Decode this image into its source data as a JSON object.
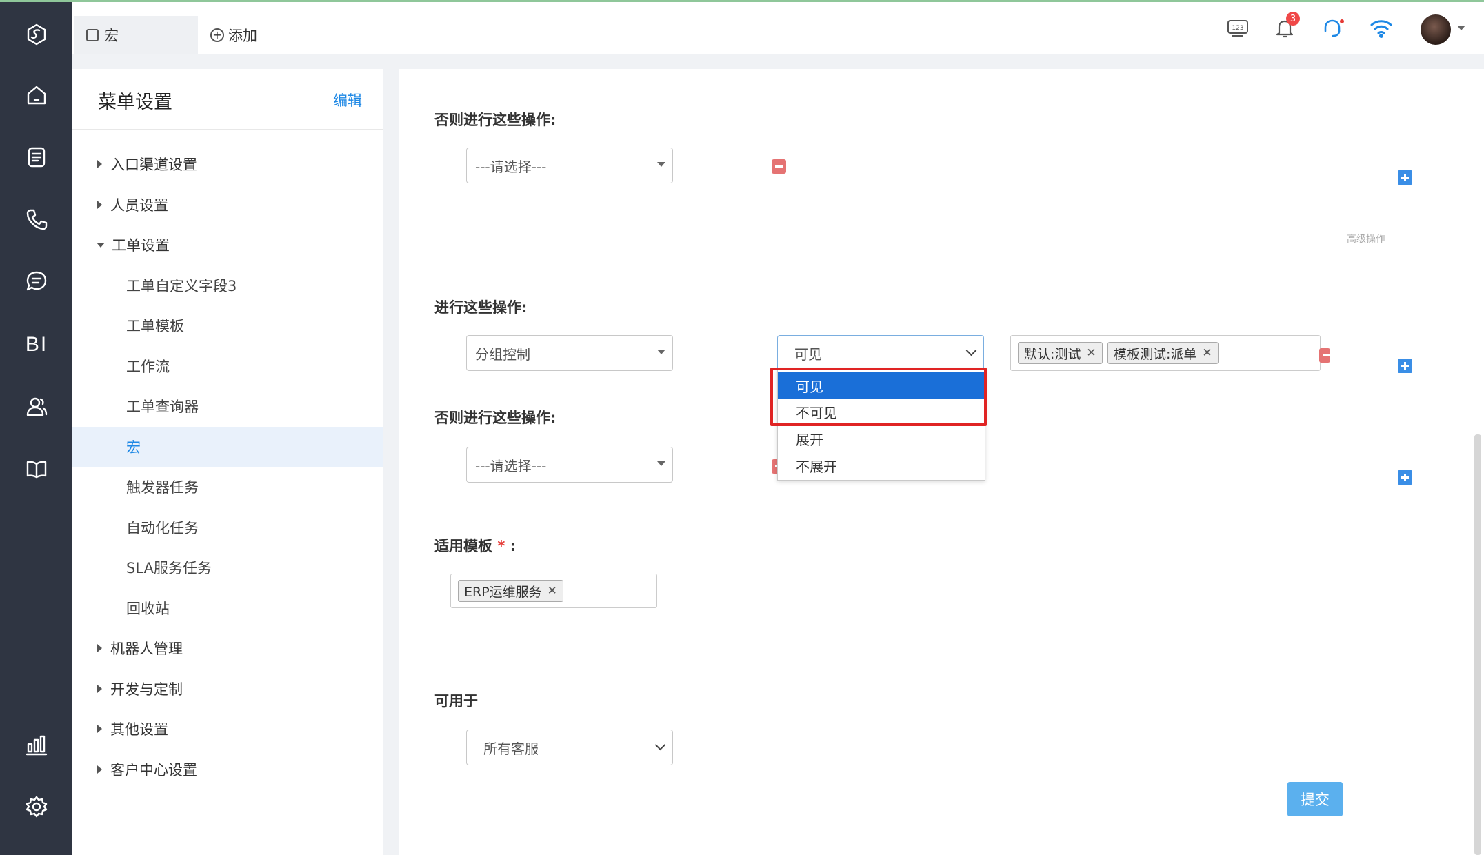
{
  "header": {
    "active_tab": "宏",
    "add_tab": "添加",
    "notification_count": "3"
  },
  "rail": {
    "bi_label": "BI",
    "icons": [
      "logo-icon",
      "home-icon",
      "document-icon",
      "phone-icon",
      "chat-icon",
      "bi-icon",
      "user-icon",
      "book-icon",
      "stats-icon",
      "settings-icon"
    ]
  },
  "menu": {
    "title": "菜单设置",
    "edit": "编辑",
    "items": [
      {
        "label": "入口渠道设置"
      },
      {
        "label": "人员设置"
      },
      {
        "label": "工单设置"
      },
      {
        "label": "工单自定义字段3"
      },
      {
        "label": "工单模板"
      },
      {
        "label": "工作流"
      },
      {
        "label": "工单查询器"
      },
      {
        "label": "宏"
      },
      {
        "label": "触发器任务"
      },
      {
        "label": "自动化任务"
      },
      {
        "label": "SLA服务任务"
      },
      {
        "label": "回收站"
      },
      {
        "label": "机器人管理"
      },
      {
        "label": "开发与定制"
      },
      {
        "label": "其他设置"
      },
      {
        "label": "客户中心设置"
      }
    ]
  },
  "form": {
    "else_label_1": "否则进行这些操作:",
    "else_select_1": "---请选择---",
    "advanced": "高级操作",
    "do_label": "进行这些操作:",
    "action_select": "分组控制",
    "visibility_select": "可见",
    "dropdown_options": [
      "可见",
      "不可见",
      "展开",
      "不展开"
    ],
    "group_tags": [
      "默认:测试",
      "模板测试:派单"
    ],
    "else_label_2": "否则进行这些操作:",
    "else_select_2": "---请选择---",
    "template_label": "适用模板",
    "template_required": "*",
    "template_colon": ":",
    "template_tags": [
      "ERP运维服务"
    ],
    "available_label": "可用于",
    "available_select": "所有客服",
    "submit": "提交"
  },
  "colors": {
    "rail_bg": "#2f3542",
    "accent": "#1e88e5",
    "selected_option": "#1a6fd8",
    "highlight_border": "#e02424",
    "submit_bg": "#5bb0ee"
  }
}
